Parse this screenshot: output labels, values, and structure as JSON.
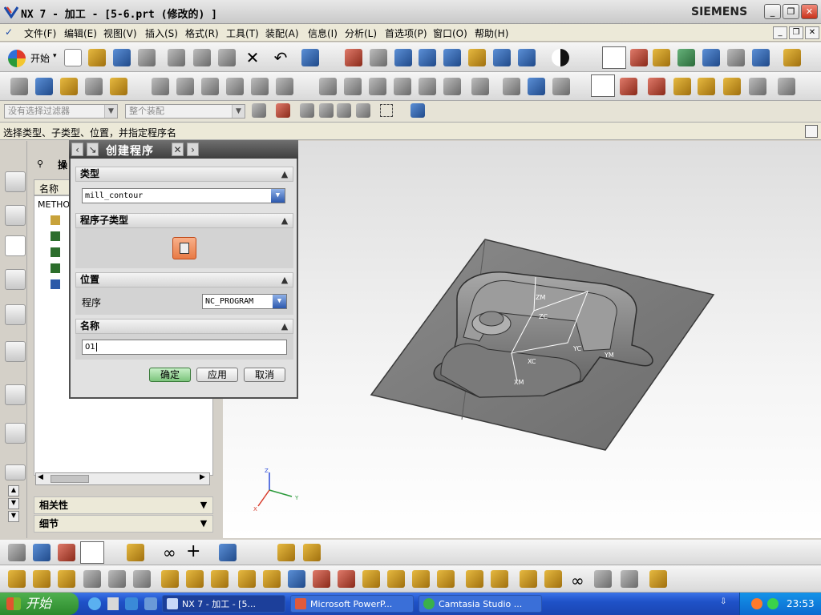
{
  "titlebar": {
    "title": "NX 7 - 加工 - [5-6.prt  (修改的) ]",
    "brand": "SIEMENS",
    "buttons": [
      "minimize",
      "restore",
      "close"
    ]
  },
  "menu": {
    "items": [
      "文件(F)",
      "编辑(E)",
      "视图(V)",
      "插入(S)",
      "格式(R)",
      "工具(T)",
      "装配(A)",
      "信息(I)",
      "分析(L)",
      "首选项(P)",
      "窗口(O)",
      "帮助(H)"
    ]
  },
  "toolbar": {
    "start_label": "开始",
    "start_arrow": "▾"
  },
  "filters": {
    "type_filter": "没有选择过滤器",
    "scope_filter": "整个装配"
  },
  "cue_line": "选择类型、子类型、位置，并指定程序名",
  "navigator": {
    "title": "操",
    "column": "名称",
    "root": "METHO",
    "sections": [
      "相关性",
      "细节"
    ]
  },
  "dialog": {
    "title": "创建程序",
    "groups": {
      "type": "类型",
      "subtype": "程序子类型",
      "location": "位置",
      "name": "名称"
    },
    "type_value": "mill_contour",
    "program_label": "程序",
    "program_value": "NC_PROGRAM",
    "name_value": "01",
    "buttons": {
      "ok": "确定",
      "apply": "应用",
      "cancel": "取消"
    }
  },
  "taskbar": {
    "start": "开始",
    "tasks": [
      "NX 7 - 加工 - [5...",
      "Microsoft PowerP...",
      "Camtasia Studio ..."
    ],
    "clock": "23:53"
  },
  "viewport": {
    "csys_labels": [
      "ZM",
      "ZC",
      "XC",
      "XM",
      "YC",
      "YM"
    ],
    "triad_labels": [
      "Z",
      "Y",
      "X"
    ]
  },
  "colors": {
    "dialog_header": "#4a4a4a",
    "ok_button": "#7cc47c",
    "taskbar": "#245edb",
    "part_gray": "#7d7d7d"
  }
}
